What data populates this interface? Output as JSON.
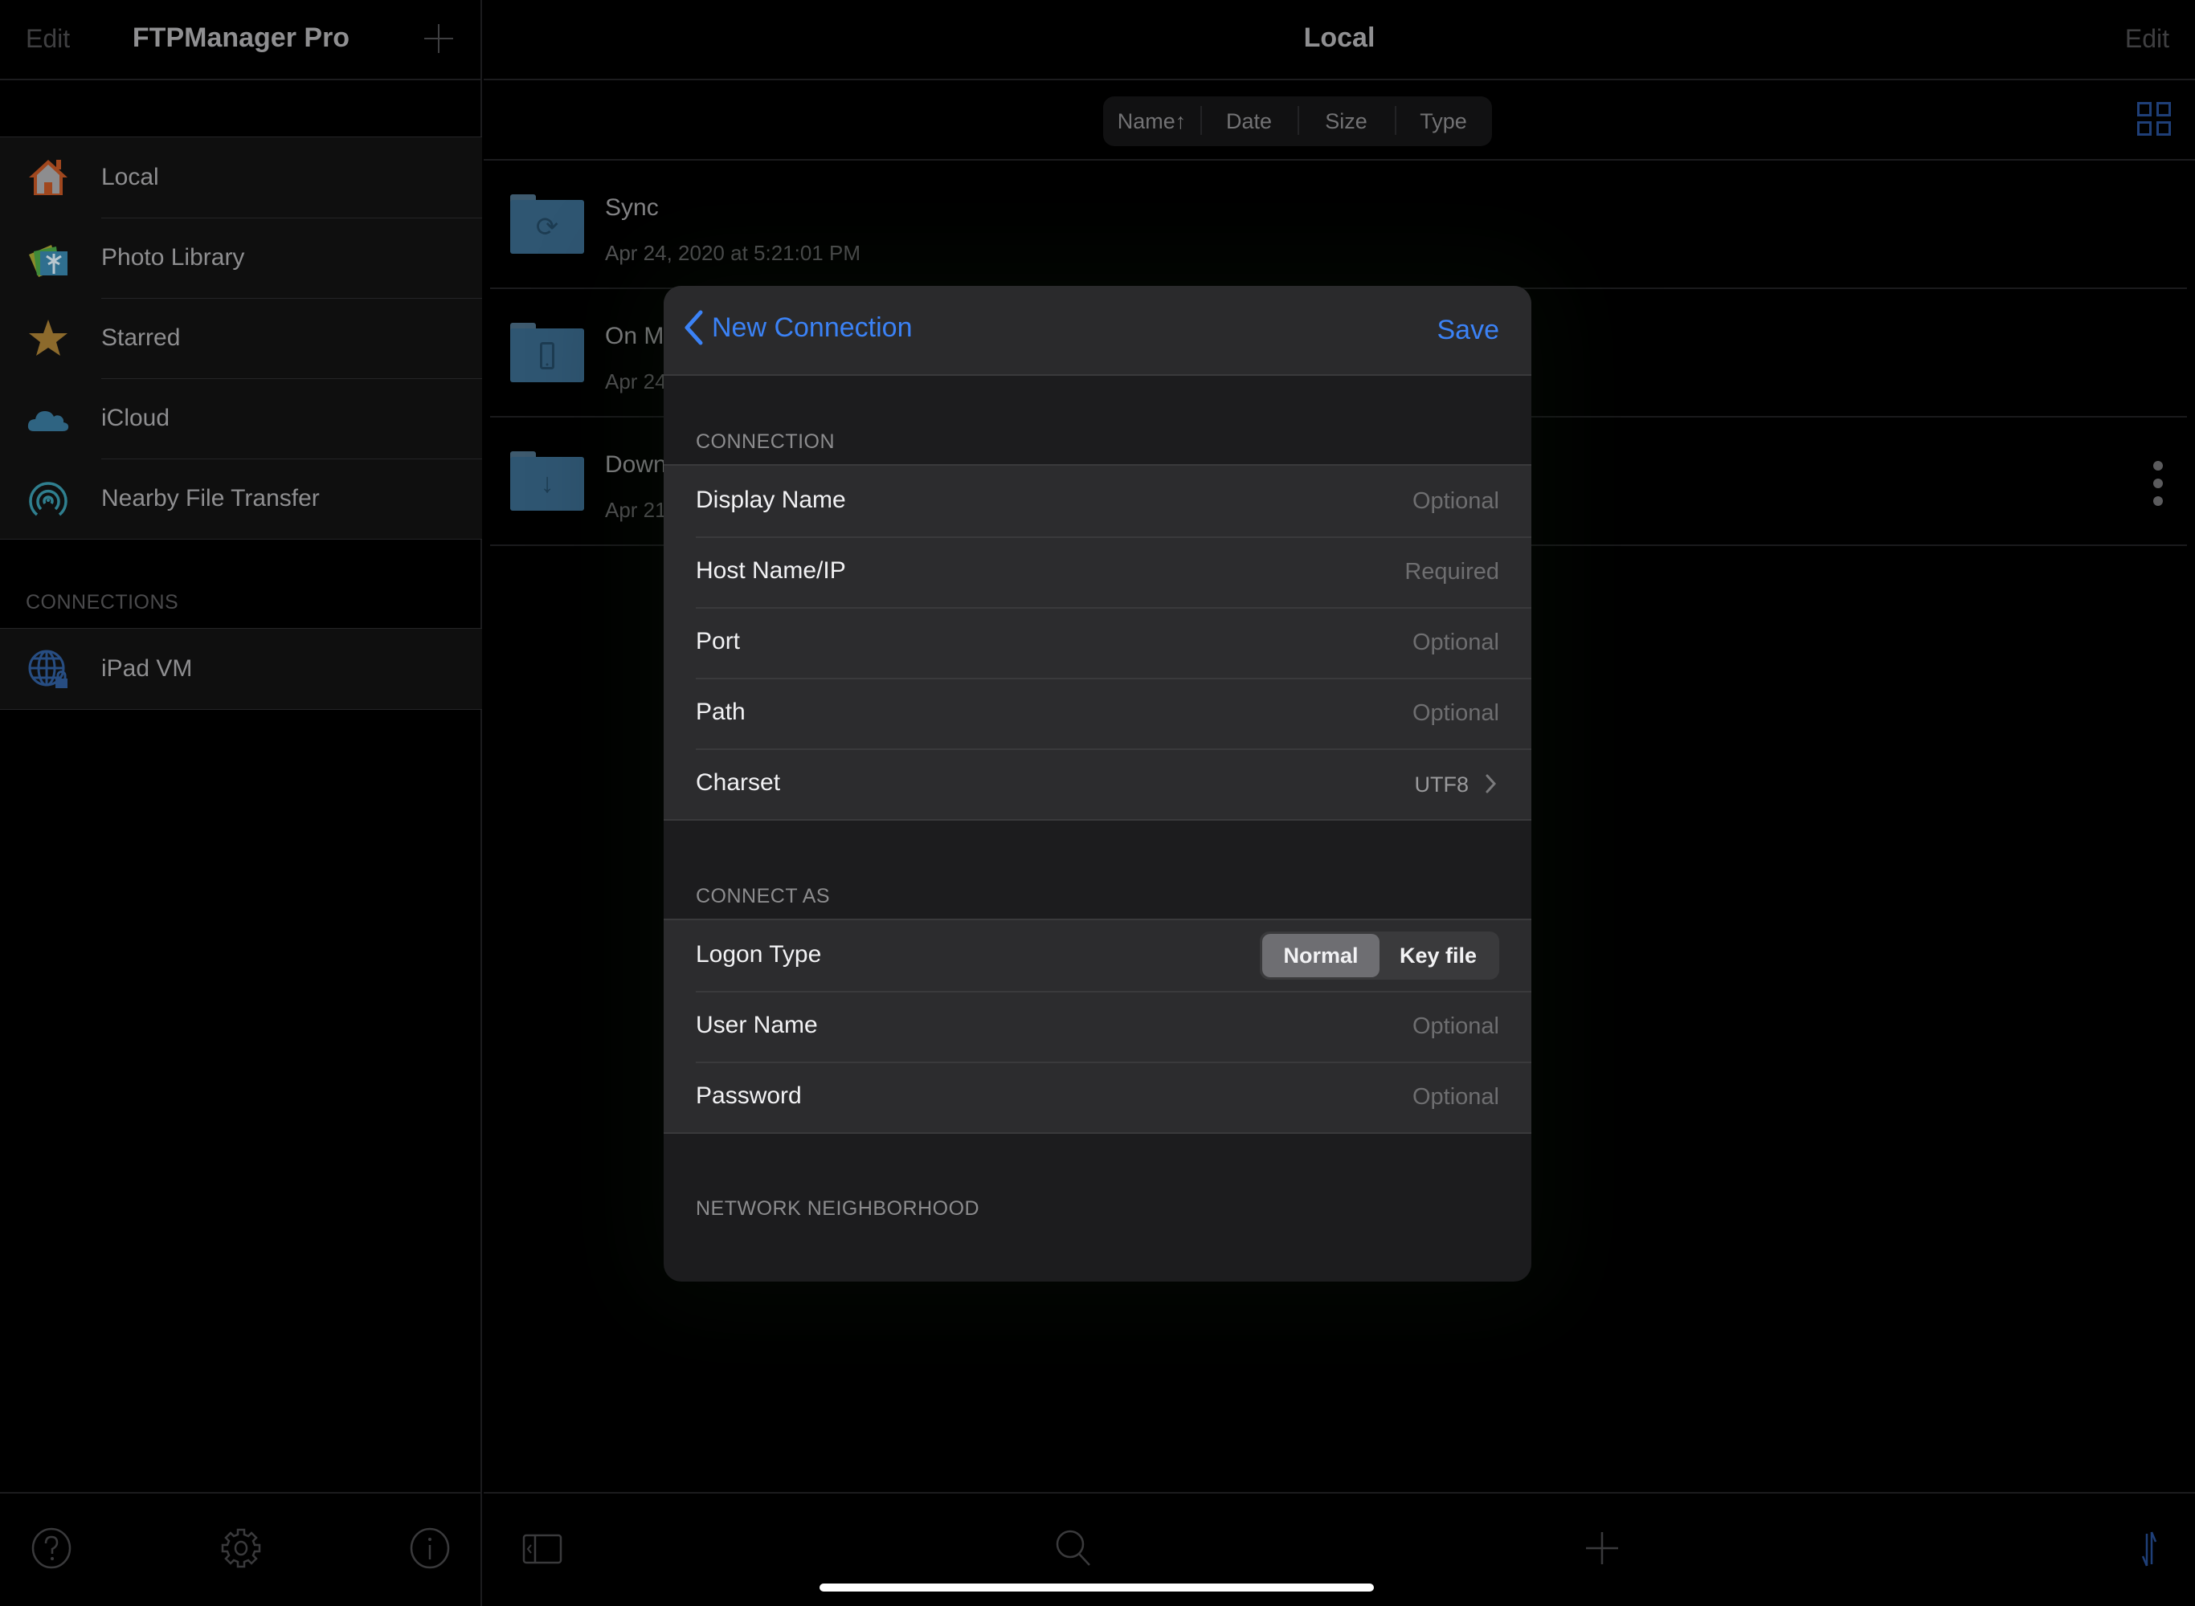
{
  "sidebar": {
    "edit_label": "Edit",
    "title": "FTPManager Pro",
    "add_icon": "plus-icon",
    "items": [
      {
        "label": "Local",
        "icon": "house-icon"
      },
      {
        "label": "Photo Library",
        "icon": "photo-library-icon"
      },
      {
        "label": "Starred",
        "icon": "star-icon"
      },
      {
        "label": "iCloud",
        "icon": "cloud-icon"
      },
      {
        "label": "Nearby File Transfer",
        "icon": "airdrop-icon"
      }
    ],
    "connections_header": "CONNECTIONS",
    "connections": [
      {
        "label": "iPad VM",
        "icon": "globe-lock-icon"
      }
    ],
    "toolbar": [
      "help-icon",
      "gear-icon",
      "info-icon"
    ]
  },
  "main": {
    "title": "Local",
    "edit_label": "Edit",
    "sort": {
      "options": [
        "Name↑",
        "Date",
        "Size",
        "Type"
      ],
      "active": "Name↑"
    },
    "view_toggle_icon": "grid-icon",
    "files": [
      {
        "name": "Sync",
        "date": "Apr 24, 2020 at 5:21:01 PM",
        "glyph": "sync-icon"
      },
      {
        "name": "On My iPad",
        "visible_name": "On M",
        "date": "Apr 24",
        "glyph": "device-icon"
      },
      {
        "name": "Downloads",
        "visible_name": "Down",
        "date": "Apr 21",
        "glyph": "download-icon"
      }
    ],
    "toolbar": [
      "sidebar-toggle-icon",
      "search-icon",
      "plus-icon",
      "transfer-icon"
    ]
  },
  "modal": {
    "back_label": "New Connection",
    "save_label": "Save",
    "sections": {
      "connection": {
        "header": "CONNECTION",
        "rows": [
          {
            "label": "Display Name",
            "placeholder": "Optional",
            "value": ""
          },
          {
            "label": "Host Name/IP",
            "placeholder": "Required",
            "value": ""
          },
          {
            "label": "Port",
            "placeholder": "Optional",
            "value": ""
          },
          {
            "label": "Path",
            "placeholder": "Optional",
            "value": ""
          }
        ],
        "charset": {
          "label": "Charset",
          "value": "UTF8"
        }
      },
      "connect_as": {
        "header": "CONNECT AS",
        "logon_type": {
          "label": "Logon Type",
          "options": [
            "Normal",
            "Key file"
          ],
          "selected": "Normal"
        },
        "rows": [
          {
            "label": "User Name",
            "placeholder": "Optional",
            "value": ""
          },
          {
            "label": "Password",
            "placeholder": "Optional",
            "value": ""
          }
        ]
      },
      "network_neighborhood": {
        "header": "NETWORK NEIGHBORHOOD"
      }
    }
  },
  "colors": {
    "accent": "#3b82f6",
    "background": "#000000",
    "modal_background": "#1c1c1e",
    "row_background": "#2c2c2e"
  }
}
